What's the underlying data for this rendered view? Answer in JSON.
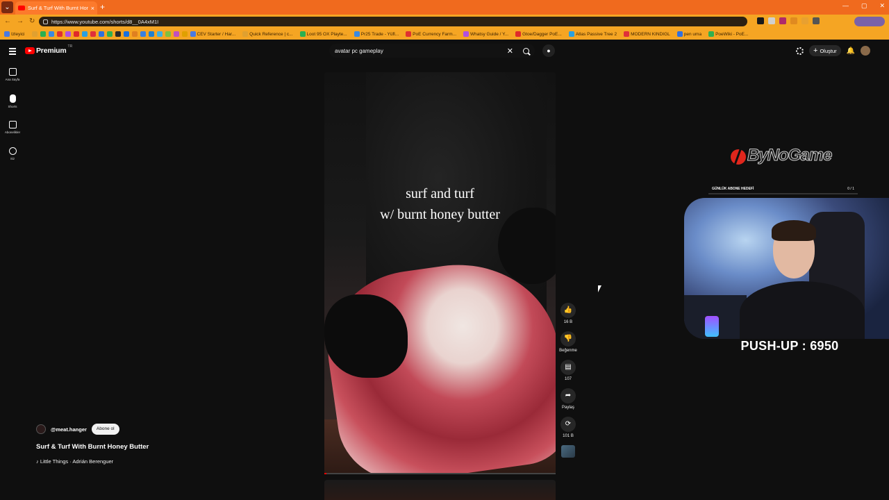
{
  "browser": {
    "tab_title": "Surf & Turf With Burnt Hone",
    "url": "https://www.youtube.com/shorts/d8__0A4xM1I",
    "bookmarks": [
      "Izleyici",
      "",
      "",
      "",
      "",
      "",
      "",
      "",
      "",
      "",
      "",
      "",
      "",
      "",
      "",
      "",
      "",
      "",
      "",
      "",
      "CEV Starter / Har...",
      "Quick Reference | c...",
      "Loot 95 OX Playte...",
      "Pr25 Trade - Yüfl...",
      "PoE Currency Farm...",
      "Whatsy Guide / Y...",
      "Gtoe/Dagger PoE...",
      "Atlas Passive Tree 2",
      "MODERN KINDIGL",
      "pen uma",
      "PoeWiki - PoE..."
    ]
  },
  "youtube": {
    "logo_text": "Premium",
    "logo_region": "TR",
    "search_query": "avatar pc gameplay",
    "create_label": "Oluştur",
    "sidebar": [
      {
        "label": "Ana Sayfa",
        "icon": "home-icon"
      },
      {
        "label": "Shorts",
        "icon": "shorts-icon"
      },
      {
        "label": "Abonelikler",
        "icon": "subscriptions-icon"
      },
      {
        "label": "Siz",
        "icon": "profile-icon"
      }
    ]
  },
  "short": {
    "overlay_line1": "surf and turf",
    "overlay_line2": "w/ burnt honey butter",
    "channel": "@meat.hanger",
    "subscribe_label": "Abone ol",
    "title": "Surf & Turf With Burnt Honey Butter",
    "music": "♪ Little Things · Adrián Berenguer",
    "progress_percent": 1,
    "actions": {
      "like_count": "16 B",
      "dislike_label": "Beğenme",
      "comment_count": "107",
      "share_label": "Paylaş",
      "remix_count": "101 B"
    }
  },
  "stream_overlay": {
    "brand": "ByNoGame",
    "goal_label": "GÜNLÜK ABONE HEDEFİ",
    "goal_count": "0 / 1",
    "pushup_text": "PUSH-UP : 6950"
  },
  "colors": {
    "tabbar": "#f06a1e",
    "navbar": "#f5a523",
    "yt_red": "#ff0000",
    "bg": "#0f0f0f"
  }
}
